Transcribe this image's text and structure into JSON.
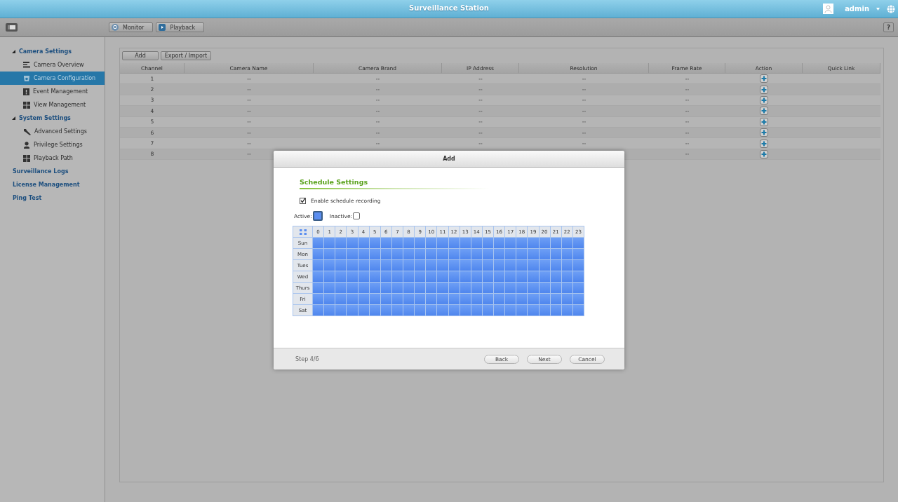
{
  "app": {
    "title": "Surveillance Station",
    "user": "admin"
  },
  "toolbar": {
    "buttons": [
      {
        "label": "Monitor",
        "kind": "monitor"
      },
      {
        "label": "Playback",
        "kind": "playback"
      }
    ],
    "help": "?"
  },
  "sidebar": {
    "items": [
      {
        "label": "Camera Settings",
        "expanded": true,
        "children": [
          {
            "label": "Camera Overview",
            "selected": false
          },
          {
            "label": "Camera Configuration",
            "selected": true
          },
          {
            "label": "Event Management",
            "selected": false
          },
          {
            "label": "View Management",
            "selected": false
          }
        ]
      },
      {
        "label": "System Settings",
        "expanded": true,
        "children": [
          {
            "label": "Advanced Settings",
            "selected": false
          },
          {
            "label": "Privilege Settings",
            "selected": false
          },
          {
            "label": "Playback Path",
            "selected": false
          }
        ]
      },
      {
        "label": "Surveillance Logs",
        "selected": false
      },
      {
        "label": "License Management",
        "selected": false
      },
      {
        "label": "Ping Test",
        "selected": false
      }
    ]
  },
  "table": {
    "buttons": [
      "Add",
      "Export / Import"
    ],
    "columns": [
      "Channel",
      "Camera Name",
      "Camera Brand",
      "IP Address",
      "Resolution",
      "Frame Rate",
      "Action",
      "Quick Link"
    ],
    "rows": [
      {
        "cells": [
          "1",
          "--",
          "--",
          "--",
          "--",
          "--"
        ]
      },
      {
        "cells": [
          "2",
          "--",
          "--",
          "--",
          "--",
          "--"
        ]
      },
      {
        "cells": [
          "3",
          "--",
          "--",
          "--",
          "--",
          "--"
        ]
      },
      {
        "cells": [
          "4",
          "--",
          "--",
          "--",
          "--",
          "--"
        ]
      },
      {
        "cells": [
          "5",
          "--",
          "--",
          "--",
          "--",
          "--"
        ]
      },
      {
        "cells": [
          "6",
          "--",
          "--",
          "--",
          "--",
          "--"
        ]
      },
      {
        "cells": [
          "7",
          "--",
          "--",
          "--",
          "--",
          "--"
        ]
      },
      {
        "cells": [
          "8",
          "--",
          null,
          null,
          null,
          "--"
        ]
      }
    ]
  },
  "dialog": {
    "title": "Add",
    "section": "Schedule Settings",
    "enable": {
      "label": "Enable schedule recording",
      "checked": true
    },
    "legend": [
      {
        "label": "Active:",
        "kind": "active",
        "selected": true
      },
      {
        "label": "Inactive:",
        "kind": "inactive",
        "selected": false
      }
    ],
    "hours": [
      "0",
      "1",
      "2",
      "3",
      "4",
      "5",
      "6",
      "7",
      "8",
      "9",
      "10",
      "11",
      "12",
      "13",
      "14",
      "15",
      "16",
      "17",
      "18",
      "19",
      "20",
      "21",
      "22",
      "23"
    ],
    "days": [
      {
        "label": "Sun",
        "slots": [
          true,
          true,
          true,
          true,
          true,
          true,
          true,
          true,
          true,
          true,
          true,
          true,
          true,
          true,
          true,
          true,
          true,
          true,
          true,
          true,
          true,
          true,
          true,
          true
        ]
      },
      {
        "label": "Mon",
        "slots": [
          true,
          true,
          true,
          true,
          true,
          true,
          true,
          true,
          true,
          true,
          true,
          true,
          true,
          true,
          true,
          true,
          true,
          true,
          true,
          true,
          true,
          true,
          true,
          true
        ]
      },
      {
        "label": "Tues",
        "slots": [
          true,
          true,
          true,
          true,
          true,
          true,
          true,
          true,
          true,
          true,
          true,
          true,
          true,
          true,
          true,
          true,
          true,
          true,
          true,
          true,
          true,
          true,
          true,
          true
        ]
      },
      {
        "label": "Wed",
        "slots": [
          true,
          true,
          true,
          true,
          true,
          true,
          true,
          true,
          true,
          true,
          true,
          true,
          true,
          true,
          true,
          true,
          true,
          true,
          true,
          true,
          true,
          true,
          true,
          true
        ]
      },
      {
        "label": "Thurs",
        "slots": [
          true,
          true,
          true,
          true,
          true,
          true,
          true,
          true,
          true,
          true,
          true,
          true,
          true,
          true,
          true,
          true,
          true,
          true,
          true,
          true,
          true,
          true,
          true,
          true
        ]
      },
      {
        "label": "Fri",
        "slots": [
          true,
          true,
          true,
          true,
          true,
          true,
          true,
          true,
          true,
          true,
          true,
          true,
          true,
          true,
          true,
          true,
          true,
          true,
          true,
          true,
          true,
          true,
          true,
          true
        ]
      },
      {
        "label": "Sat",
        "slots": [
          true,
          true,
          true,
          true,
          true,
          true,
          true,
          true,
          true,
          true,
          true,
          true,
          true,
          true,
          true,
          true,
          true,
          true,
          true,
          true,
          true,
          true,
          true,
          true
        ]
      }
    ],
    "step": "Step 4/6",
    "buttons": [
      "Back",
      "Next",
      "Cancel"
    ]
  }
}
